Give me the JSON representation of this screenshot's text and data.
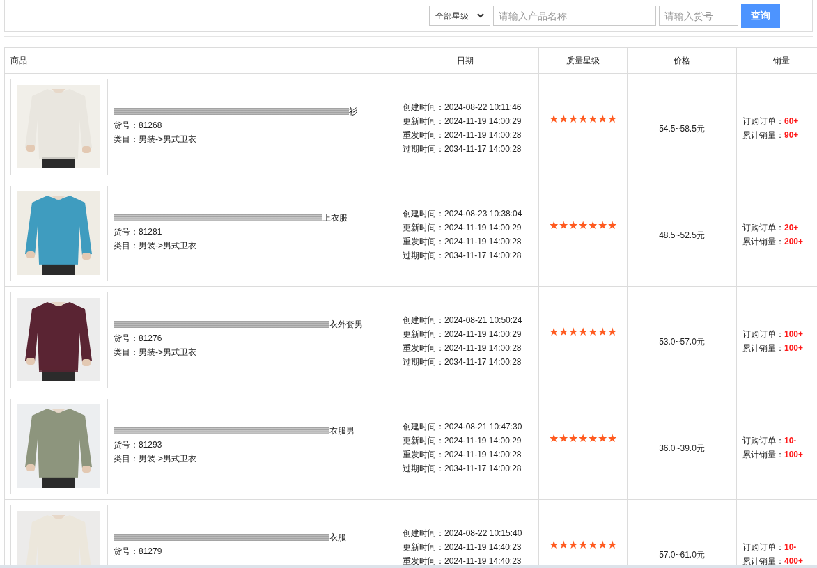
{
  "toolbar": {
    "level_select": "全部星级",
    "name_search": {
      "placeholder": "请输入产品名称"
    },
    "sku_search": {
      "placeholder": "请输入货号"
    },
    "query_button": "查询"
  },
  "table": {
    "columns": [
      "商品",
      "日期",
      "质量星级",
      "价格",
      "销量"
    ],
    "rows": [
      {
        "image": {
          "kind": "picture"
        },
        "title": "衫",
        "sku": "货号：81268",
        "category": "类目：男装->男式卫衣",
        "dates": [
          "创建时间：2024-08-22 10:11:46",
          "更新时间：2024-11-19 14:00:29",
          "重发时间：2024-11-19 14:00:28",
          "过期时间：2034-11-17 14:00:28"
        ],
        "stars": 7,
        "price": "54.5~58.5元",
        "sales": [
          {
            "label": "订购订单：",
            "value": "60+"
          },
          {
            "label": "累计销量：",
            "value": "90+"
          }
        ]
      },
      {
        "image": {
          "kind": "picture"
        },
        "title": "上衣服",
        "sku": "货号：81281",
        "category": "类目：男装->男式卫衣",
        "dates": [
          "创建时间：2024-08-23 10:38:04",
          "更新时间：2024-11-19 14:00:29",
          "重发时间：2024-11-19 14:00:28",
          "过期时间：2034-11-17 14:00:28"
        ],
        "stars": 7,
        "price": "48.5~52.5元",
        "sales": [
          {
            "label": "订购订单：",
            "value": "20+"
          },
          {
            "label": "累计销量：",
            "value": "200+"
          }
        ]
      },
      {
        "image": {
          "kind": "picture"
        },
        "title": "衣外套男",
        "sku": "货号：81276",
        "category": "类目：男装->男式卫衣",
        "dates": [
          "创建时间：2024-08-21 10:50:24",
          "更新时间：2024-11-19 14:00:29",
          "重发时间：2024-11-19 14:00:28",
          "过期时间：2034-11-17 14:00:28"
        ],
        "stars": 7,
        "price": "53.0~57.0元",
        "sales": [
          {
            "label": "订购订单：",
            "value": "100+"
          },
          {
            "label": "累计销量：",
            "value": "100+"
          }
        ]
      },
      {
        "image": {
          "kind": "picture"
        },
        "title": "衣服男",
        "sku": "货号：81293",
        "category": "类目：男装->男式卫衣",
        "dates": [
          "创建时间：2024-08-21 10:47:30",
          "更新时间：2024-11-19 14:00:29",
          "重发时间：2024-11-19 14:00:28",
          "过期时间：2034-11-17 14:00:28"
        ],
        "stars": 7,
        "price": "36.0~39.0元",
        "sales": [
          {
            "label": "订购订单：",
            "value": "10-"
          },
          {
            "label": "累计销量：",
            "value": "100+"
          }
        ]
      },
      {
        "image": {
          "kind": "picture"
        },
        "title": "衣服",
        "sku": "货号：81279",
        "dates": [
          "创建时间：2024-08-22 10:15:40",
          "更新时间：2024-11-19 14:40:23",
          "重发时间：2024-11-19 14:40:23"
        ],
        "stars": 7,
        "price": "57.0~61.0元",
        "sales": [
          {
            "label": "订购订单：",
            "value": "10-"
          },
          {
            "label": "累计销量：",
            "value": "400+"
          }
        ]
      }
    ]
  }
}
